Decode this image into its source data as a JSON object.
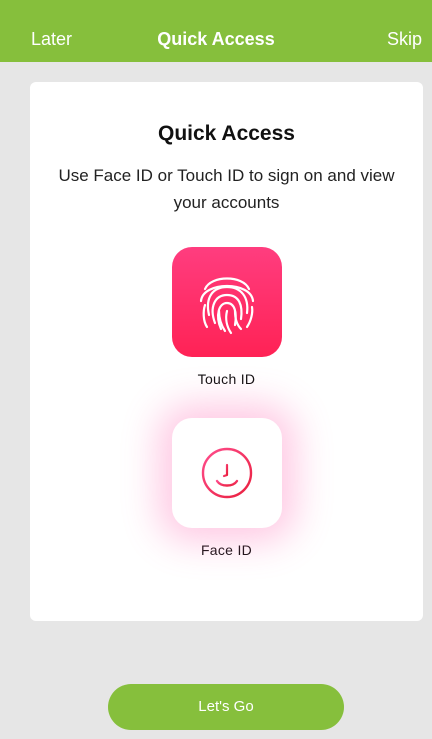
{
  "navbar": {
    "left_label": "Later",
    "title": "Quick Access",
    "right_label": "Skip",
    "background_color": "#86bf3c"
  },
  "card": {
    "title": "Quick Access",
    "subtitle": "Use Face ID or Touch ID to sign on and view your accounts",
    "options": [
      {
        "label": "Touch ID",
        "icon": "fingerprint-icon",
        "tile_color": "#ff2a66"
      },
      {
        "label": "Face ID",
        "icon": "face-icon",
        "tile_color": "#ffffff"
      }
    ]
  },
  "footer": {
    "button_label": "Let's Go",
    "button_color": "#86bf3c"
  }
}
